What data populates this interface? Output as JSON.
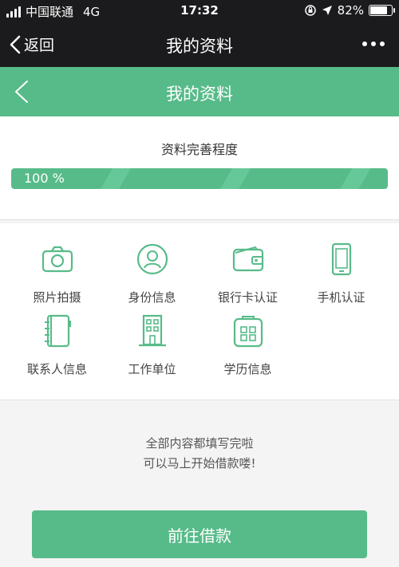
{
  "status_bar": {
    "carrier": "中国联通",
    "network": "4G",
    "time": "17:32",
    "battery_percent": "82%",
    "battery_level": 0.82
  },
  "wechat_bar": {
    "back_label": "返回",
    "title": "我的资料"
  },
  "header": {
    "title": "我的资料"
  },
  "progress": {
    "label": "资料完善程度",
    "text": "100 %",
    "value": 1.0
  },
  "items": [
    {
      "label": "照片拍摄",
      "icon": "camera-icon"
    },
    {
      "label": "身份信息",
      "icon": "id-avatar-icon"
    },
    {
      "label": "银行卡认证",
      "icon": "wallet-icon"
    },
    {
      "label": "手机认证",
      "icon": "phone-icon"
    },
    {
      "label": "联系人信息",
      "icon": "contacts-book-icon"
    },
    {
      "label": "工作单位",
      "icon": "building-icon"
    },
    {
      "label": "学历信息",
      "icon": "schoolbag-icon"
    }
  ],
  "message": {
    "line1": "全部内容都填写完啦",
    "line2": "可以马上开始借款喽!"
  },
  "cta_label": "前往借款",
  "colors": {
    "accent": "#57bb89",
    "dark_bar": "#1b1b1d",
    "background": "#f4f4f4"
  }
}
